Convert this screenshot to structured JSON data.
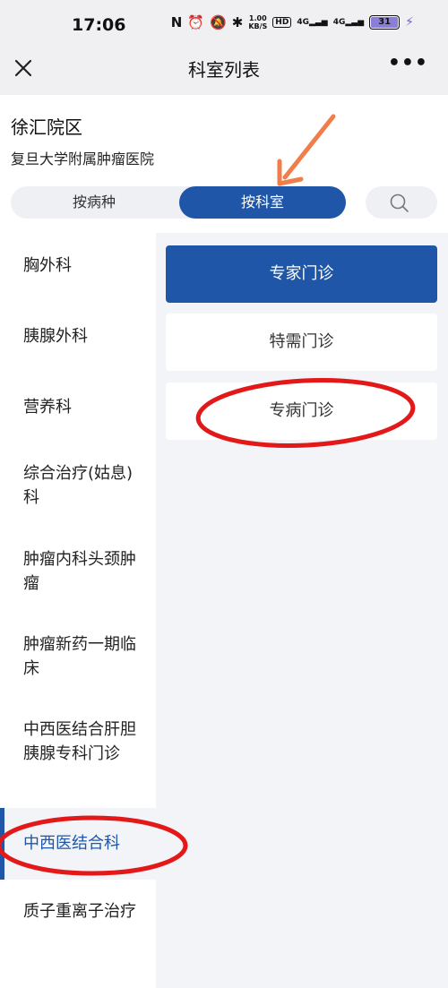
{
  "status_bar": {
    "time": "17:06",
    "icons": [
      "nfc-icon",
      "alarm-icon",
      "mute-icon",
      "bluetooth-icon"
    ],
    "net_speed": [
      "1.00",
      "KB/S"
    ],
    "hd_label": "HD",
    "signal_1": "4G",
    "signal_2": "4G",
    "battery": "31"
  },
  "nav": {
    "title": "科室列表",
    "more": "•••"
  },
  "campus": {
    "name": "徐汇院区",
    "hospital": "复旦大学附属肿瘤医院"
  },
  "segment": {
    "by_disease": "按病种",
    "by_department": "按科室",
    "selected": "按科室"
  },
  "departments": [
    "胸外科",
    "胰腺外科",
    "营养科",
    "综合治疗(姑息)科",
    "肿瘤内科头颈肿瘤",
    "肿瘤新药一期临床",
    "中西医结合肝胆胰腺专科门诊",
    "中西医结合科",
    "质子重离子治疗"
  ],
  "selected_department": "中西医结合科",
  "clinics": [
    "专家门诊",
    "特需门诊",
    "专病门诊"
  ],
  "selected_clinic": "专家门诊",
  "colors": {
    "primary": "#1f56a8",
    "annotation_circle": "#e31919",
    "annotation_arrow": "#f07d4a",
    "header_bg": "#f0f0f2",
    "pane_bg": "#f3f4f7"
  }
}
